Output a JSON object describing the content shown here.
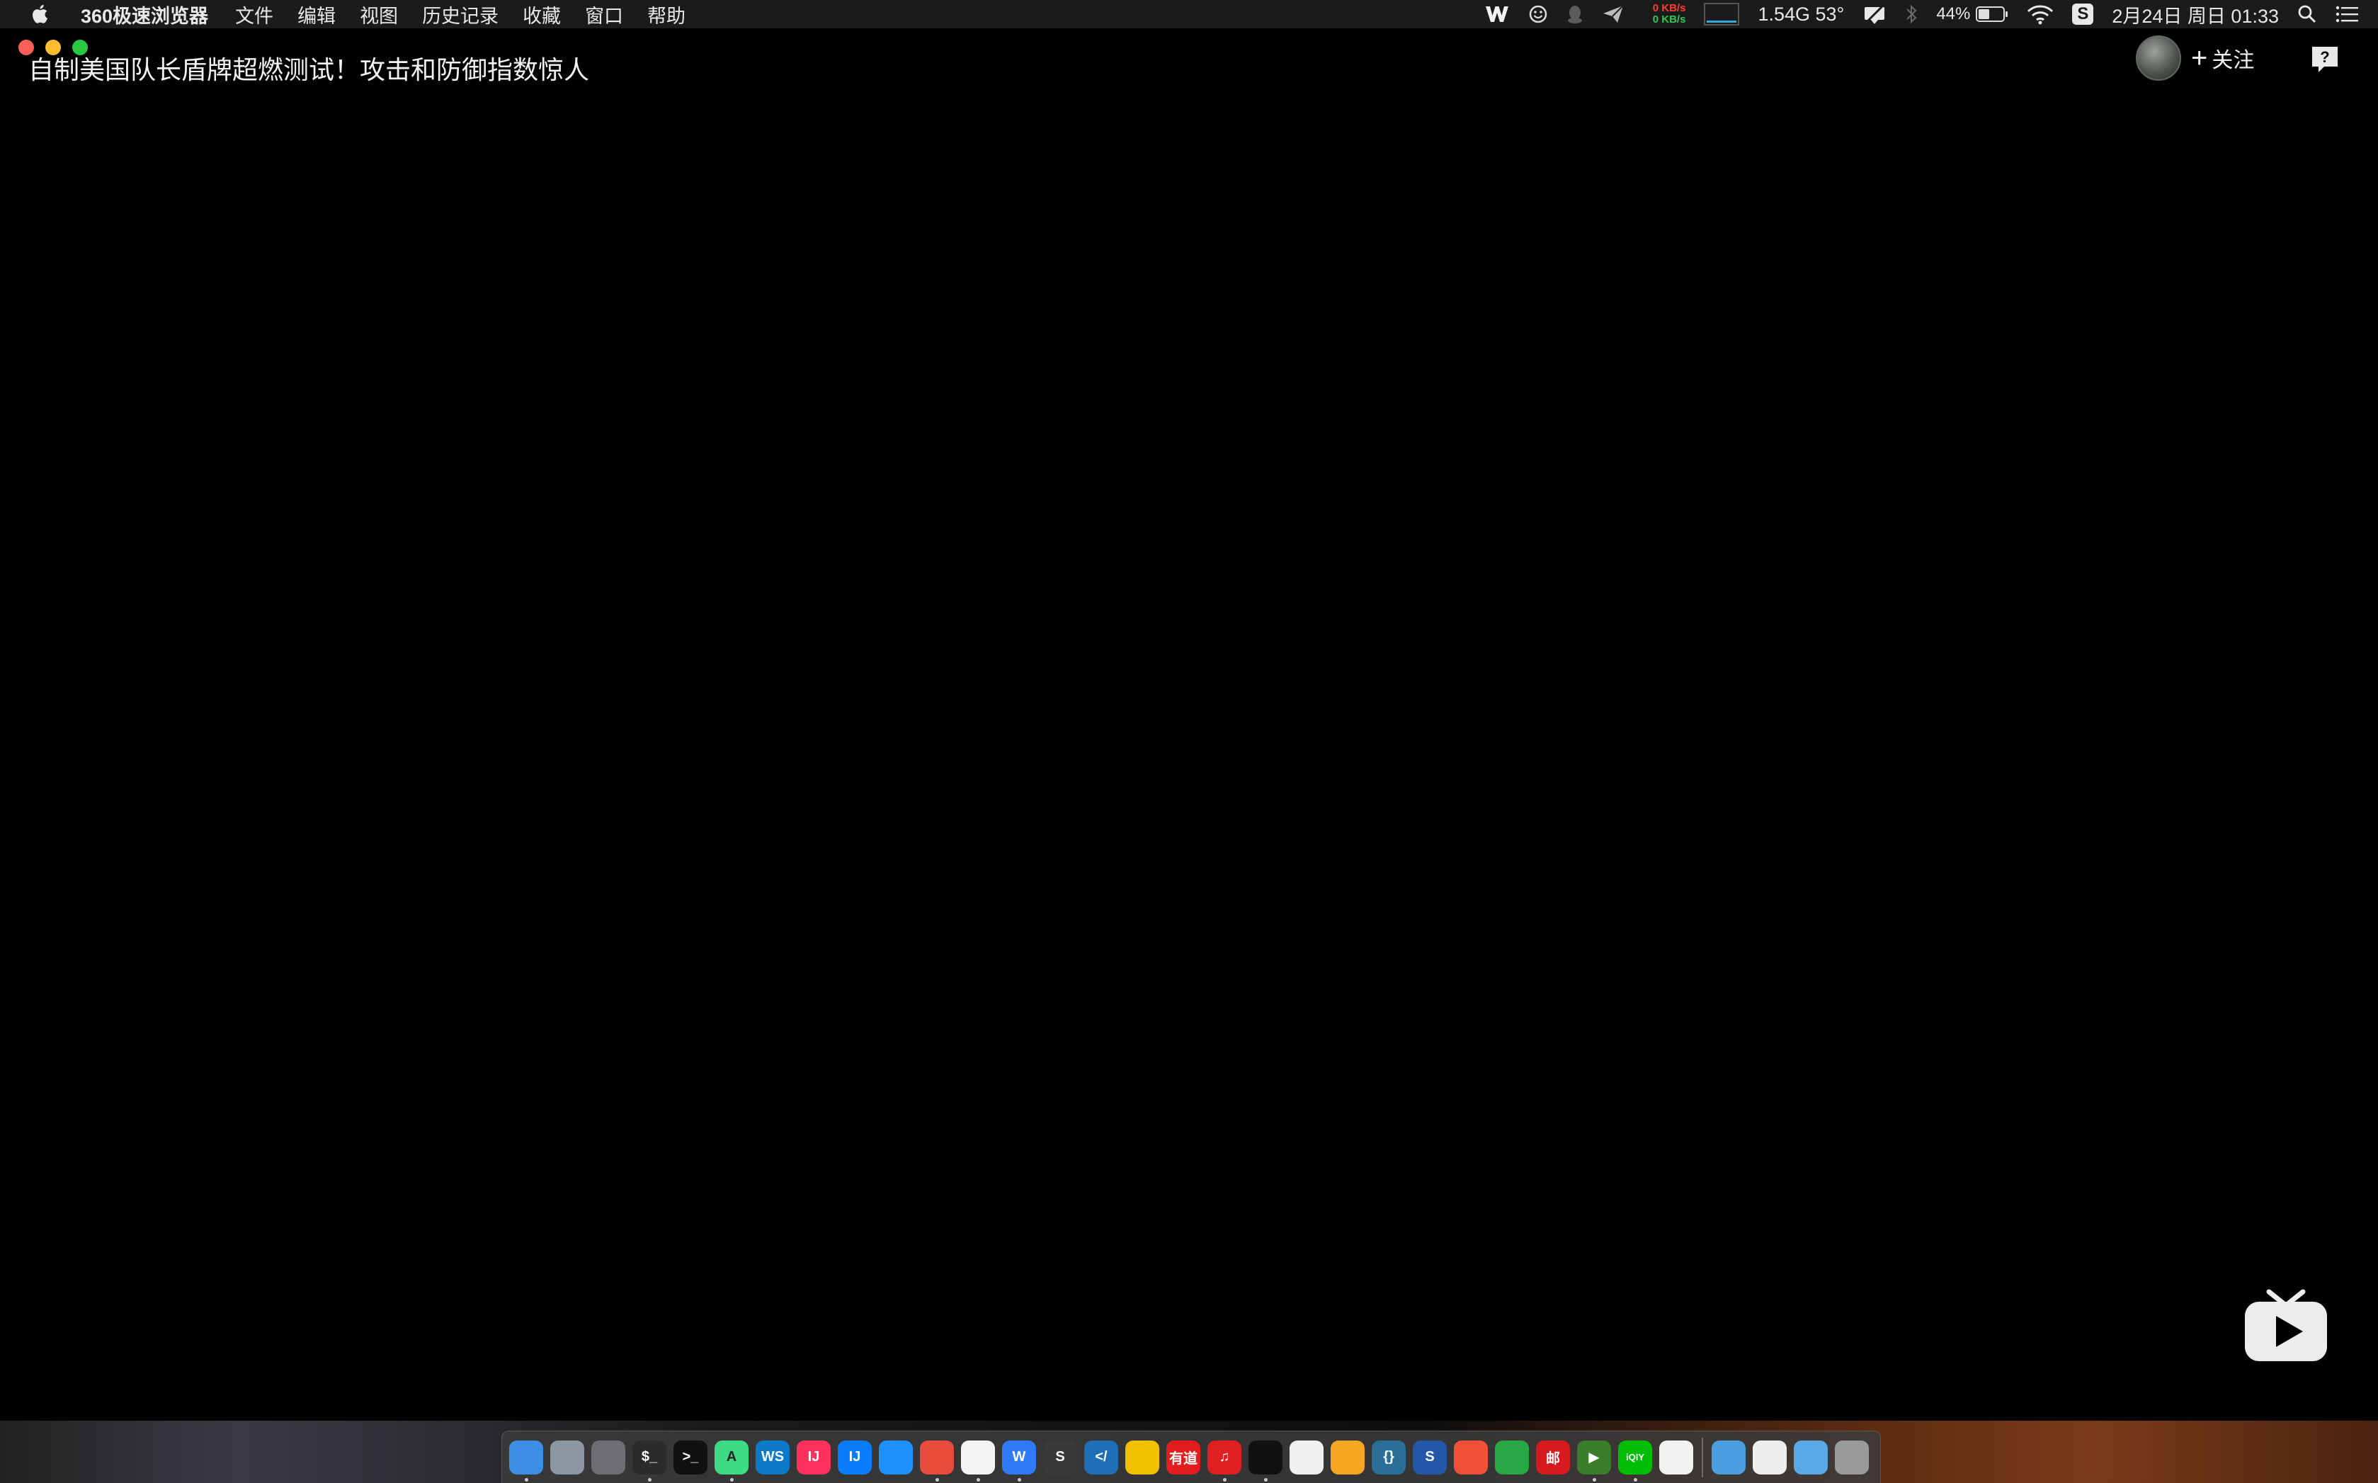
{
  "menubar": {
    "app_name": "360极速浏览器",
    "menus": [
      "文件",
      "编辑",
      "视图",
      "历史记录",
      "收藏",
      "窗口",
      "帮助"
    ],
    "network_up": "0 KB/s",
    "network_down": "0 KB/s",
    "memory_temp": "1.54G 53°",
    "battery": "44%",
    "clock": "2月24日 周日 01:33"
  },
  "video": {
    "title": "自制美国队长盾牌超燃测试！攻击和防御指数惊人",
    "follow_label": "关注"
  },
  "dock": {
    "apps": [
      {
        "name": "finder",
        "color": "#3d8fe6",
        "label": ""
      },
      {
        "name": "launchpad",
        "color": "#8d96a3",
        "label": ""
      },
      {
        "name": "system-preferences",
        "color": "#6e6e73",
        "label": ""
      },
      {
        "name": "activity-terminal",
        "color": "#2b2b2b",
        "label": "$_"
      },
      {
        "name": "terminal",
        "color": "#111111",
        "label": ">_"
      },
      {
        "name": "android-studio",
        "color": "#3ddc84",
        "label": "A"
      },
      {
        "name": "webstorm",
        "color": "#0c7ac7",
        "label": "WS"
      },
      {
        "name": "intellij-idea",
        "color": "#fe315d",
        "label": "IJ"
      },
      {
        "name": "intellij-idea-ce",
        "color": "#087cfa",
        "label": "IJ"
      },
      {
        "name": "safari",
        "color": "#1e90ff",
        "label": ""
      },
      {
        "name": "360-browser",
        "color": "#e84c3d",
        "label": ""
      },
      {
        "name": "chrome",
        "color": "#f4f4f4",
        "label": ""
      },
      {
        "name": "wps-writer",
        "color": "#2f7bf6",
        "label": "W"
      },
      {
        "name": "sublime-text",
        "color": "#3a3a3a",
        "label": "S"
      },
      {
        "name": "vscode",
        "color": "#1f6fb7",
        "label": "</"
      },
      {
        "name": "sogou",
        "color": "#f3c000",
        "label": ""
      },
      {
        "name": "youdao-dict",
        "color": "#e11d1d",
        "label": "有道"
      },
      {
        "name": "netease-music",
        "color": "#e02020",
        "label": "♫"
      },
      {
        "name": "qq",
        "color": "#111111",
        "label": ""
      },
      {
        "name": "wechat",
        "color": "#f0f0f0",
        "label": ""
      },
      {
        "name": "notes-pen",
        "color": "#f5a623",
        "label": ""
      },
      {
        "name": "json-editor",
        "color": "#2a6f97",
        "label": "{}"
      },
      {
        "name": "sourcetree",
        "color": "#2457a8",
        "label": "S"
      },
      {
        "name": "swift-playground",
        "color": "#f05138",
        "label": ""
      },
      {
        "name": "telegram",
        "color": "#27a844",
        "label": ""
      },
      {
        "name": "netease-mail",
        "color": "#d71920",
        "label": "邮"
      },
      {
        "name": "tencent-video",
        "color": "#3a7d2b",
        "label": "▶"
      },
      {
        "name": "iqiyi",
        "color": "#00be06",
        "label": "iQIY"
      },
      {
        "name": "baidu-netdisk",
        "color": "#f2f2f2",
        "label": ""
      },
      {
        "name": "app-store-folder",
        "color": "#4a9fe0",
        "label": ""
      },
      {
        "name": "documents",
        "color": "#eeeeee",
        "label": ""
      },
      {
        "name": "downloads-folder",
        "color": "#5aa9e6",
        "label": ""
      },
      {
        "name": "trash",
        "color": "#9a9a9a",
        "label": ""
      }
    ]
  }
}
